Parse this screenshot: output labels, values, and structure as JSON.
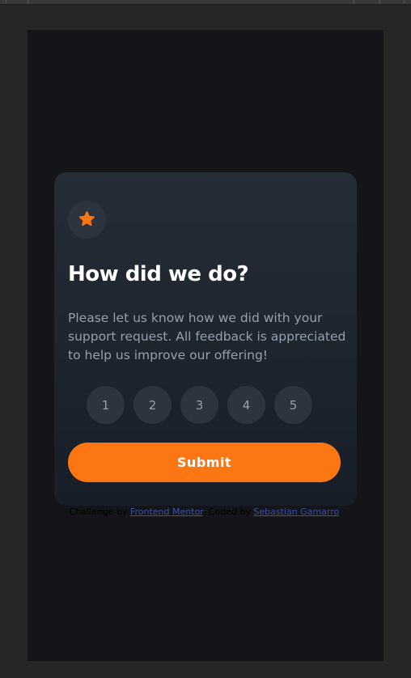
{
  "card": {
    "icon": "star-icon",
    "title": "How did we do?",
    "description": "Please let us know how we did with your support request. All feedback is appreciated to help us improve our offering!",
    "ratings": [
      "1",
      "2",
      "3",
      "4",
      "5"
    ],
    "submit_label": "Submit"
  },
  "attribution": {
    "prefix": "Challenge by",
    "challenge_link": "Frontend Mentor",
    "middle": ". Coded by",
    "author_link": "Sebastian Gamarro",
    "suffix": "."
  },
  "colors": {
    "accent": "#fc7614",
    "card_top": "#252d37",
    "card_bottom": "#171e28",
    "muted_text": "#969fad",
    "circle_bg": "#2c343f",
    "page_bg": "#131518",
    "link": "#3e52a3"
  }
}
